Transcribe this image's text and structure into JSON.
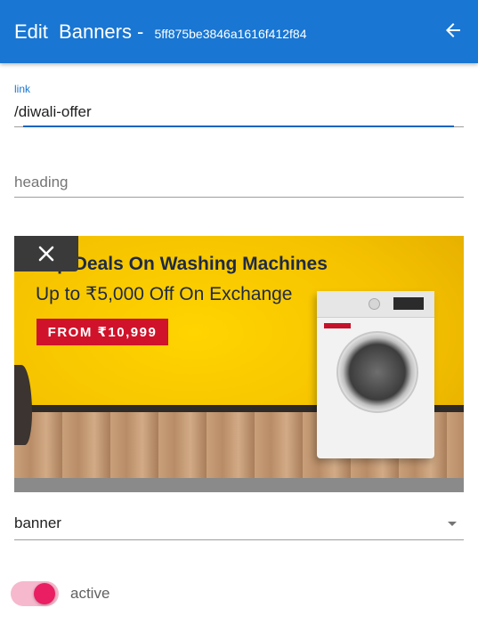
{
  "appbar": {
    "title_word1": "Edit",
    "title_word2": "Banners",
    "title_dash": "-",
    "record_id": "5ff875be3846a1616f412f84",
    "back_icon": "arrow-left-icon",
    "color": "#1976d2"
  },
  "form": {
    "link": {
      "label": "link",
      "value": "/diwali-offer"
    },
    "heading": {
      "placeholder": "heading",
      "value": ""
    },
    "image": {
      "close_icon": "close-icon",
      "headline": "Top Deals On Washing Machines",
      "subline": "Up to ₹5,000 Off On Exchange",
      "badge": "FROM ₹10,999"
    },
    "type_select": {
      "value": "banner",
      "icon": "dropdown-arrow-icon"
    },
    "active_toggle": {
      "label": "active",
      "checked": true,
      "color": "#e91e63"
    }
  }
}
